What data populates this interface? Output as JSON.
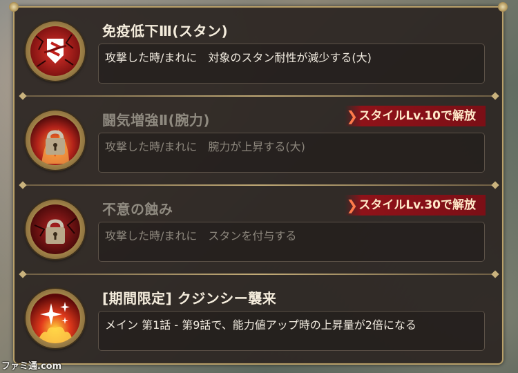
{
  "skills": [
    {
      "name": "免疫低下Ⅲ(スタン)",
      "description": "攻撃した時/まれに　対象のスタン耐性が減少する(大)",
      "locked": false,
      "icon": "immunity-down-icon"
    },
    {
      "name": "闘気増強Ⅱ(腕力)",
      "description": "攻撃した時/まれに　腕力が上昇する(大)",
      "locked": true,
      "unlock_label": "スタイルLv.10で解放",
      "icon": "locked-power-up-icon"
    },
    {
      "name": "不意の蝕み",
      "description": "攻撃した時/まれに　スタンを付与する",
      "locked": true,
      "unlock_label": "スタイルLv.30で解放",
      "icon": "locked-erosion-icon"
    },
    {
      "name": "[期間限定] クジンシー襲来",
      "description": "メイン 第1話 - 第9話で、能力値アップ時の上昇量が2倍になる",
      "locked": false,
      "icon": "sparkle-flame-icon"
    }
  ],
  "watermark": "ファミ通.com",
  "colors": {
    "panel_border": "#b8a06a",
    "unlock_badge": "#8f1219",
    "active_text": "#f4ecdc",
    "locked_text": "#8f8a80"
  }
}
